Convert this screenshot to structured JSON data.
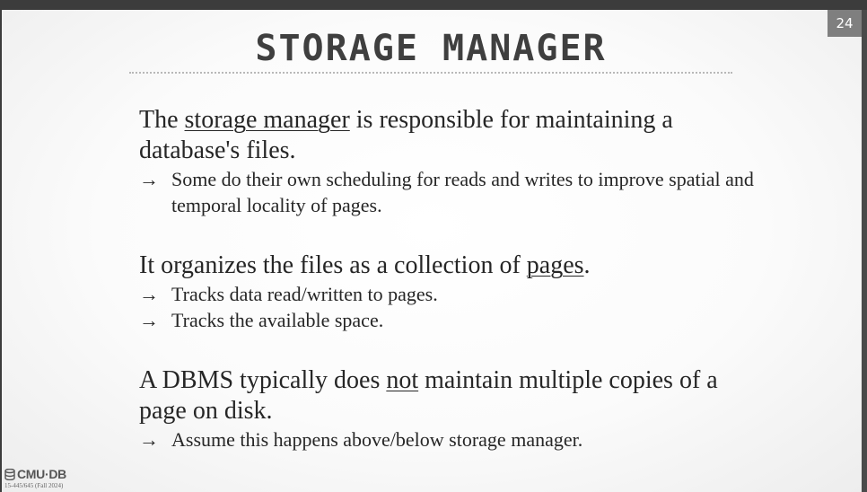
{
  "slide_number": "24",
  "title": "STORAGE MANAGER",
  "section1": {
    "pre": "The ",
    "link": "storage manager",
    "post": " is responsible for maintaining a database's files.",
    "bullets": [
      "Some do their own scheduling for reads and writes to improve spatial and temporal locality of pages."
    ]
  },
  "section2": {
    "pre": "It organizes the files as a collection of ",
    "link": "pages",
    "post": ".",
    "bullets": [
      "Tracks data read/written to pages.",
      "Tracks the available space."
    ]
  },
  "section3": {
    "pre": "A DBMS typically does ",
    "link": "not",
    "post": " maintain multiple copies of a page on disk.",
    "bullets": [
      "Assume this happens above/below storage manager."
    ]
  },
  "arrow_glyph": "→",
  "logo": {
    "name": "CMU·DB",
    "course": "15-445/645 (Fall 2024)",
    "icon": "database-icon"
  }
}
